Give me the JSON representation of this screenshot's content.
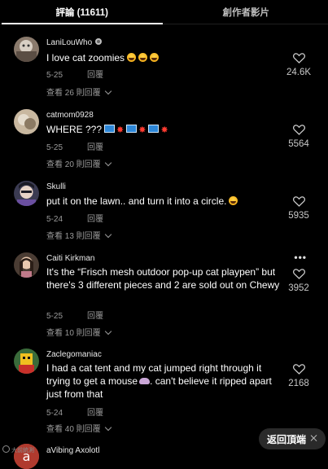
{
  "tabs": [
    {
      "label": "評論 (11611)",
      "active": true
    },
    {
      "label": "創作者影片",
      "active": false
    }
  ],
  "comments": [
    {
      "username": "LaniLouWho",
      "text": "I love cat zoomies",
      "emoji": [
        "grinning-face",
        "grinning-face",
        "grinning-face"
      ],
      "date": "5-25",
      "reply_label": "回覆",
      "view_replies": "查看 26 則回覆",
      "likes": "24.6K"
    },
    {
      "username": "catmom0928",
      "text": "WHERE ???",
      "emoji": [
        "flag",
        "burst",
        "flag",
        "burst",
        "flag",
        "burst"
      ],
      "date": "5-25",
      "reply_label": "回覆",
      "view_replies": "查看 20 則回覆",
      "likes": "5564"
    },
    {
      "username": "Skulli",
      "text": "put it on the lawn.. and turn it into a circle.",
      "emoji": [
        "grinning-face"
      ],
      "date": "5-24",
      "reply_label": "回覆",
      "view_replies": "查看 13 則回覆",
      "likes": "5935"
    },
    {
      "username": "Caiti Kirkman",
      "text": "It's the “Frisch mesh outdoor pop-up cat playpen” but there's 3 different pieces and 2 are sold out on Chewy",
      "date": "5-25",
      "reply_label": "回覆",
      "view_replies": "查看 10 則回覆",
      "likes": "3952"
    },
    {
      "username": "Zaclegomaniac",
      "text": "I had a cat tent and my cat jumped right through it trying to get a mouse",
      "text_tail": ". can't believe it ripped apart just from that",
      "emoji": [
        "mouse"
      ],
      "date": "5-24",
      "reply_label": "回覆",
      "view_replies": "查看 40 則回覆",
      "likes": "2168"
    },
    {
      "username": "aVibing Axolotl"
    }
  ],
  "back_to_top": "返回頂端",
  "watermark": "大前統測",
  "colors": {
    "background": "#000000",
    "secondary_text": "#9a9a9a",
    "button_bg": "#2a2a2a"
  }
}
